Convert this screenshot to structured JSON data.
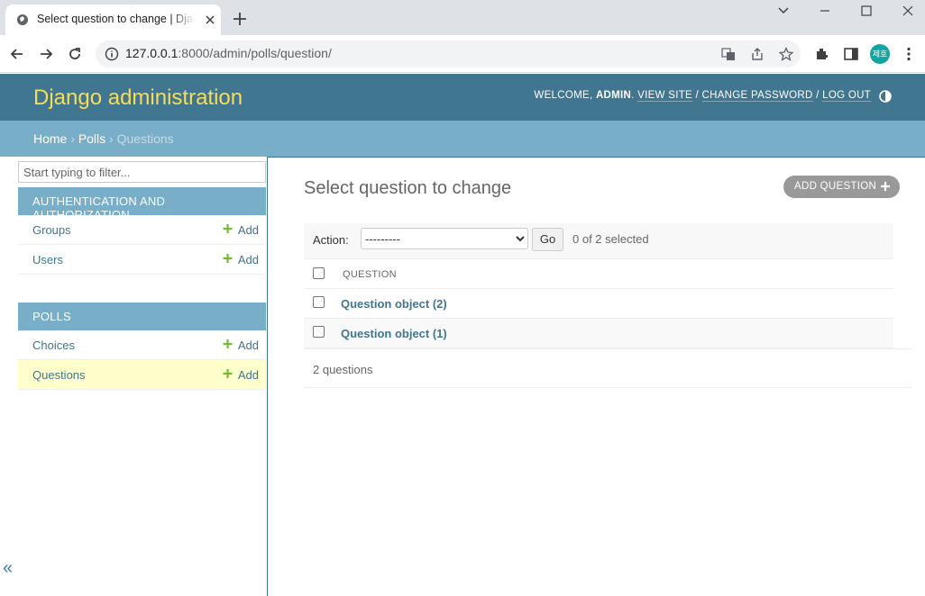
{
  "browser": {
    "tab_title": "Select question to change | Django site admin",
    "url_host": "127.0.0.1",
    "url_path": ":8000/admin/polls/question/",
    "avatar_text": "제호"
  },
  "header": {
    "branding": "Django administration",
    "welcome": "WELCOME, ",
    "username": "ADMIN",
    "sep0": ". ",
    "view_site": "VIEW SITE",
    "sep1": " / ",
    "change_password": "CHANGE PASSWORD",
    "sep2": " / ",
    "log_out": "LOG OUT"
  },
  "breadcrumbs": {
    "home": "Home",
    "polls": "Polls",
    "current": "Questions",
    "separator": " › "
  },
  "sidebar": {
    "filter_placeholder": "Start typing to filter...",
    "apps": [
      {
        "caption": "AUTHENTICATION AND AUTHORIZATION",
        "models": [
          {
            "name": "Groups",
            "add": "Add"
          },
          {
            "name": "Users",
            "add": "Add"
          }
        ]
      },
      {
        "caption": "POLLS",
        "models": [
          {
            "name": "Choices",
            "add": "Add"
          },
          {
            "name": "Questions",
            "add": "Add"
          }
        ]
      }
    ],
    "collapse_glyph": "«"
  },
  "content": {
    "title": "Select question to change",
    "add_button": "ADD QUESTION",
    "action_label": "Action:",
    "action_selected": "---------",
    "go_label": "Go",
    "selected_count": "0 of 2 selected",
    "column_header": "QUESTION",
    "rows": [
      "Question object (2)",
      "Question object (1)"
    ],
    "paginator": "2 questions"
  },
  "colors": {
    "header_bg": "#417690",
    "breadcrumbs_bg": "#79aec8",
    "branding": "#f5dd5d",
    "link": "#417690",
    "current_model_bg": "#ffffcc",
    "add_plus": "#70bf2b"
  }
}
